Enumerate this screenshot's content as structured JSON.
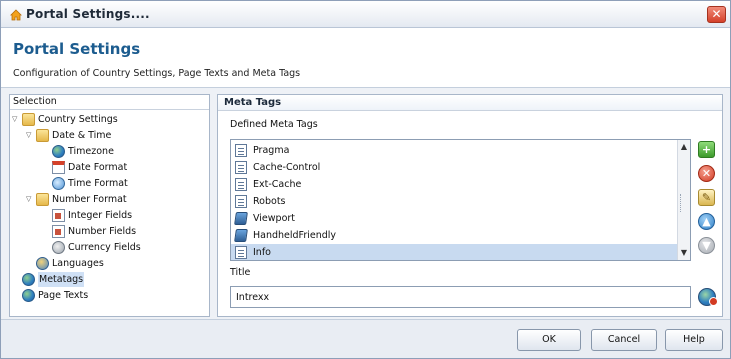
{
  "window": {
    "title": "Portal Settings...."
  },
  "header": {
    "title": "Portal Settings",
    "subtitle": "Configuration of Country Settings, Page Texts and Meta Tags"
  },
  "selection": {
    "caption": "Selection",
    "tree": {
      "country_settings": "Country Settings",
      "date_time": "Date & Time",
      "timezone": "Timezone",
      "date_format": "Date Format",
      "time_format": "Time Format",
      "number_format": "Number Format",
      "integer_fields": "Integer Fields",
      "number_fields": "Number Fields",
      "currency_fields": "Currency Fields",
      "languages": "Languages",
      "metatags": "Metatags",
      "page_texts": "Page Texts"
    }
  },
  "meta_tags": {
    "tab_label": "Meta Tags",
    "defined_label": "Defined Meta Tags",
    "items": [
      {
        "label": "Pragma",
        "icon": "document-icon"
      },
      {
        "label": "Cache-Control",
        "icon": "document-icon"
      },
      {
        "label": "Ext-Cache",
        "icon": "document-icon"
      },
      {
        "label": "Robots",
        "icon": "document-icon"
      },
      {
        "label": "Viewport",
        "icon": "device-icon"
      },
      {
        "label": "HandheldFriendly",
        "icon": "device-icon"
      },
      {
        "label": "Info",
        "icon": "document-icon"
      }
    ],
    "selected_index": 6,
    "title_label": "Title",
    "title_value": "Intrexx"
  },
  "footer": {
    "ok_label": "OK",
    "cancel_label": "Cancel",
    "help_label": "Help"
  },
  "colors": {
    "header_title": "#1c5c8f",
    "selection_bg": "#c8daf0",
    "close_button": "#d4412a"
  }
}
